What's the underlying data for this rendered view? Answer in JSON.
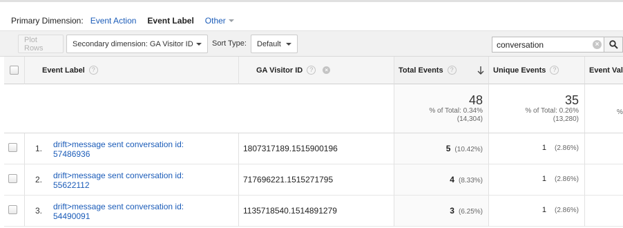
{
  "primary_dimension": {
    "label": "Primary Dimension:",
    "options": [
      "Event Action",
      "Event Label"
    ],
    "active": "Event Label",
    "other": "Other"
  },
  "controls": {
    "plot_rows": "Plot Rows",
    "secondary_dimension": "Secondary dimension: GA Visitor ID",
    "sort_type_label": "Sort Type:",
    "sort_type_value": "Default",
    "search_value": "conversation"
  },
  "columns": {
    "event_label": "Event Label",
    "visitor_id": "GA Visitor ID",
    "total_events": "Total Events",
    "unique_events": "Unique Events",
    "event_value": "Event Valu"
  },
  "totals": {
    "total_events": {
      "value": "48",
      "pct": "% of Total: 0.34%",
      "of": "(14,304)"
    },
    "unique_events": {
      "value": "35",
      "pct": "% of Total: 0.26%",
      "of": "(13,280)"
    },
    "event_value_partial": "%"
  },
  "rows": [
    {
      "num": "1.",
      "label_line1": "drift>message sent conversation id:",
      "label_line2": "57486936",
      "visitor": "1807317189.1515900196",
      "total": "5",
      "total_pct": "(10.42%)",
      "unique": "1",
      "unique_pct": "(2.86%)"
    },
    {
      "num": "2.",
      "label_line1": "drift>message sent conversation id:",
      "label_line2": "55622112",
      "visitor": "717696221.1515271795",
      "total": "4",
      "total_pct": "(8.33%)",
      "unique": "1",
      "unique_pct": "(2.86%)"
    },
    {
      "num": "3.",
      "label_line1": "drift>message sent conversation id:",
      "label_line2": "54490091",
      "visitor": "1135718540.1514891279",
      "total": "3",
      "total_pct": "(6.25%)",
      "unique": "1",
      "unique_pct": "(2.86%)"
    }
  ]
}
